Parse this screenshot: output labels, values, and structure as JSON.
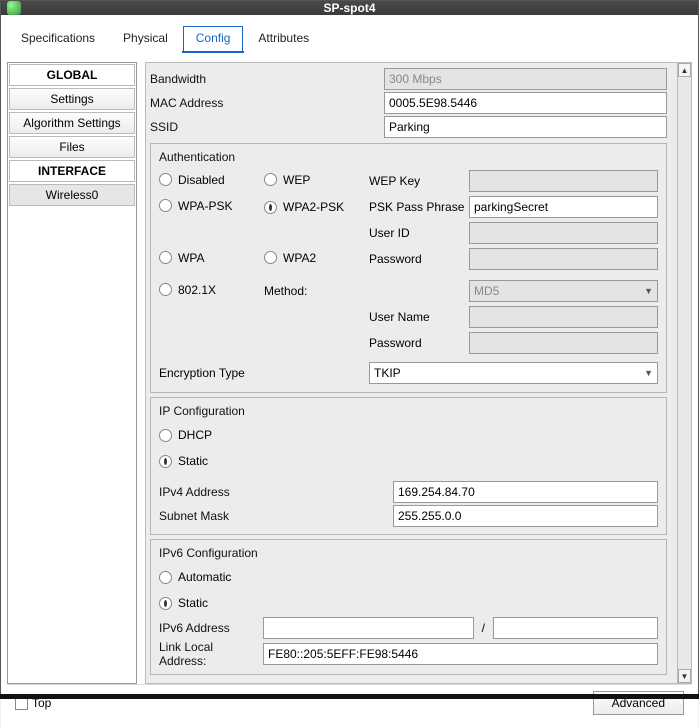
{
  "window": {
    "title": "SP-spot4"
  },
  "tabs": [
    "Specifications",
    "Physical",
    "Config",
    "Attributes"
  ],
  "sidebar": {
    "global": "GLOBAL",
    "items": [
      "Settings",
      "Algorithm Settings",
      "Files"
    ],
    "interface": "INTERFACE",
    "if_items": [
      "Wireless0"
    ]
  },
  "fields": {
    "bandwidth_label": "Bandwidth",
    "bandwidth_value": "300 Mbps",
    "mac_label": "MAC Address",
    "mac_value": "0005.5E98.5446",
    "ssid_label": "SSID",
    "ssid_value": "Parking"
  },
  "auth": {
    "title": "Authentication",
    "opts": {
      "disabled": "Disabled",
      "wep": "WEP",
      "wpapsk": "WPA-PSK",
      "wpa2psk": "WPA2-PSK",
      "wpa": "WPA",
      "wpa2": "WPA2",
      "x8021": "802.1X"
    },
    "wepkey": "WEP Key",
    "psk": "PSK Pass Phrase",
    "psk_value": "parkingSecret",
    "userid": "User ID",
    "password": "Password",
    "method": "Method:",
    "method_value": "MD5",
    "username": "User Name",
    "password2": "Password",
    "enc_label": "Encryption Type",
    "enc_value": "TKIP"
  },
  "ipconf": {
    "title": "IP Configuration",
    "dhcp": "DHCP",
    "static": "Static",
    "ipv4_label": "IPv4 Address",
    "ipv4_value": "169.254.84.70",
    "mask_label": "Subnet Mask",
    "mask_value": "255.255.0.0"
  },
  "ip6conf": {
    "title": "IPv6 Configuration",
    "auto": "Automatic",
    "static": "Static",
    "ipv6_label": "IPv6 Address",
    "lla_label": "Link Local Address:",
    "lla_value": "FE80::205:5EFF:FE98:5446"
  },
  "footer": {
    "top": "Top",
    "advanced": "Advanced"
  }
}
